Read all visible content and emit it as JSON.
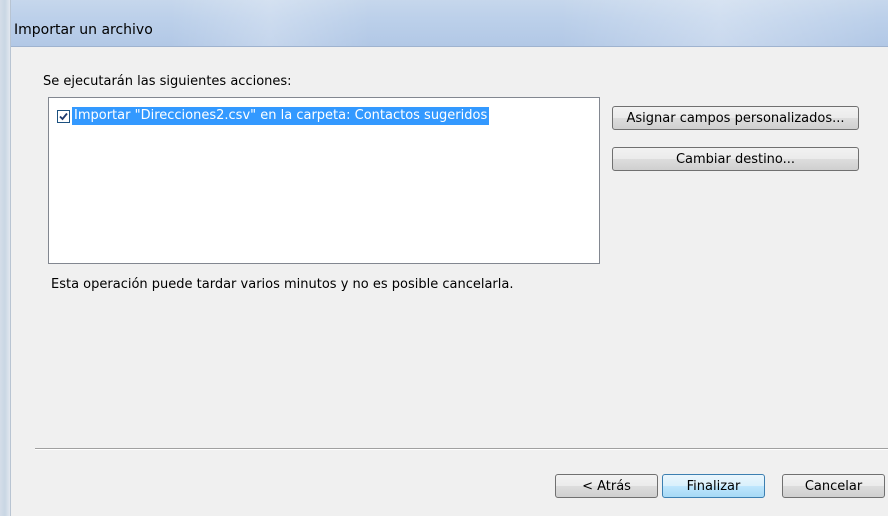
{
  "window": {
    "title": "Importar un archivo"
  },
  "main": {
    "heading": "Se ejecutarán las siguientes acciones:",
    "actions": [
      {
        "label": "Importar \"Direcciones2.csv\" en la carpeta: Contactos sugeridos",
        "checked": true,
        "selected": true
      }
    ],
    "note": "Esta operación puede tardar varios minutos y no es posible cancelarla."
  },
  "side_buttons": {
    "map_fields_label": "Asignar campos personalizados...",
    "change_destination_label": "Cambiar destino..."
  },
  "footer": {
    "back_label": "< Atrás",
    "finish_label": "Finalizar",
    "cancel_label": "Cancelar"
  },
  "colors": {
    "selection": "#3399ff",
    "titlebar": "#bcd0ea",
    "dialog_bg": "#f0f0f0"
  }
}
